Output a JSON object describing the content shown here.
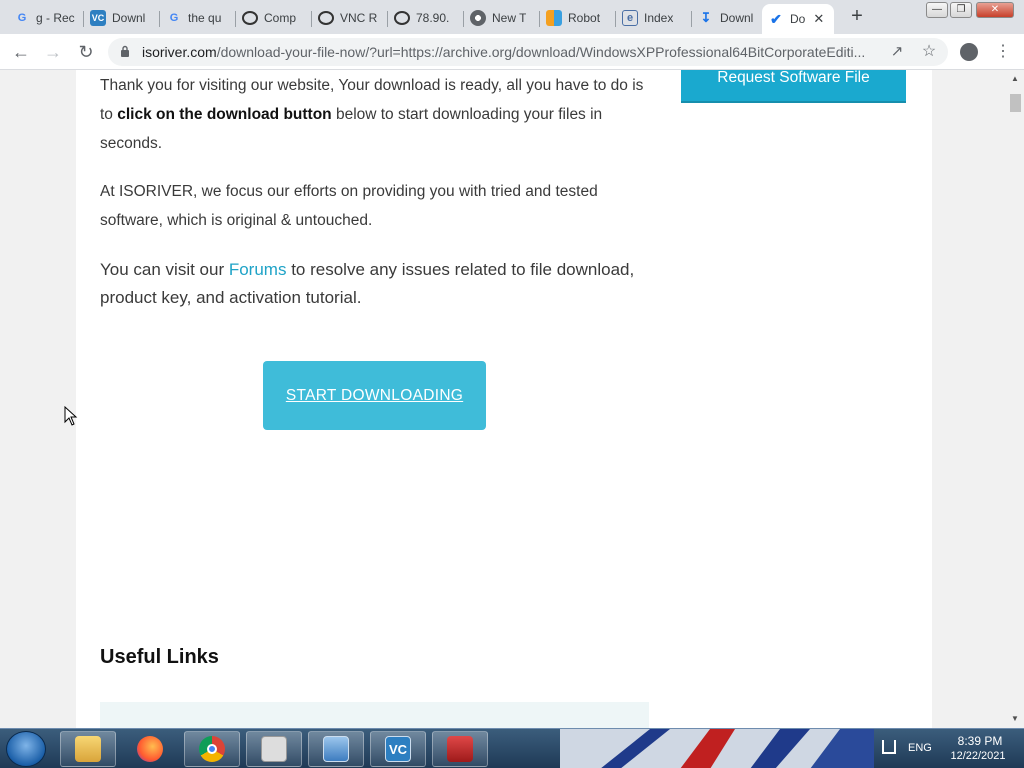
{
  "browser": {
    "tabs": [
      {
        "title": "g - Rec",
        "icon": "google-icon"
      },
      {
        "title": "Downl",
        "icon": "vnc-icon"
      },
      {
        "title": "the qu",
        "icon": "google-icon"
      },
      {
        "title": "Comp",
        "icon": "vnc-viewer-icon"
      },
      {
        "title": "VNC R",
        "icon": "vnc-viewer-icon"
      },
      {
        "title": "78.90.",
        "icon": "vnc-viewer-icon"
      },
      {
        "title": "New T",
        "icon": "chrome-icon"
      },
      {
        "title": "Robot",
        "icon": "robot-icon"
      },
      {
        "title": "Index",
        "icon": "web-page-icon"
      },
      {
        "title": "Downl",
        "icon": "download-icon"
      },
      {
        "title": "Do",
        "icon": "check-icon",
        "active": true
      }
    ],
    "url_host": "isoriver.com",
    "url_path": "/download-your-file-now/?url=https://archive.org/download/WindowsXPProfessional64BitCorporateEditi..."
  },
  "page": {
    "intro_1": "Thank you for visiting our website, Your download is ready, all you have to do is to ",
    "intro_bold": "click on the download button",
    "intro_2": " below to start downloading your files in seconds.",
    "focus_text": "At ISORIVER, we focus our efforts on providing you with tried and tested software, which is original & untouched.",
    "forums_pre": "You can visit our ",
    "forums_link": "Forums",
    "forums_post": " to resolve any issues related to file download, product key, and activation tutorial.",
    "download_button": "START DOWNLOADING",
    "request_button": "Request Software File",
    "useful_links_heading": "Useful Links"
  },
  "taskbar": {
    "language": "ENG",
    "time": "8:39 PM",
    "date": "12/22/2021"
  }
}
